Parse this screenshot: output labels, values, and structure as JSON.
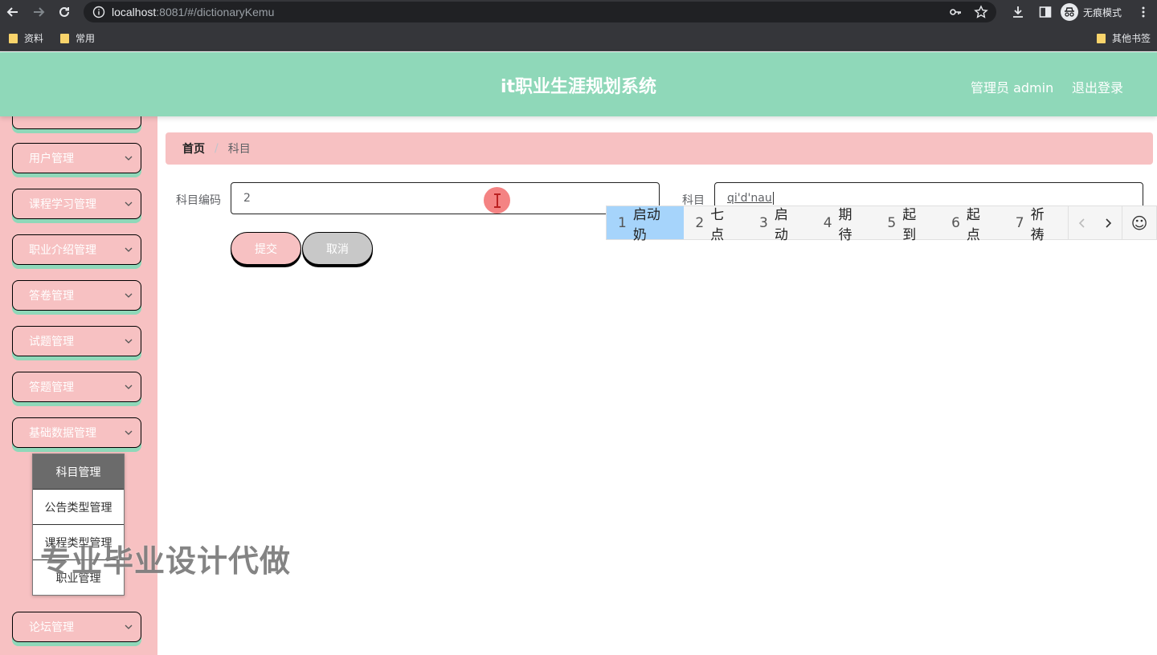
{
  "browser": {
    "url_host": "localhost",
    "url_rest": ":8081/#/dictionaryKemu",
    "incognito_label": "无痕模式",
    "bookmarks": [
      "资料",
      "常用"
    ],
    "other_bookmarks": "其他书签"
  },
  "header": {
    "title": "it职业生涯规划系统",
    "admin": "管理员 admin",
    "logout": "退出登录"
  },
  "sidebar": {
    "items": [
      {
        "label": "用户管理"
      },
      {
        "label": "课程学习管理"
      },
      {
        "label": "职业介绍管理"
      },
      {
        "label": "答卷管理"
      },
      {
        "label": "试题管理"
      },
      {
        "label": "答题管理"
      },
      {
        "label": "基础数据管理"
      },
      {
        "label": "论坛管理"
      }
    ],
    "submenu": [
      "科目管理",
      "公告类型管理",
      "课程类型管理",
      "职业管理"
    ]
  },
  "breadcrumb": {
    "home": "首页",
    "separator": "/",
    "current": "科目"
  },
  "form": {
    "code_label": "科目编码",
    "code_value": "2",
    "name_label": "科目",
    "name_value": "qi'd'nau",
    "submit": "提交",
    "cancel": "取消"
  },
  "ime": {
    "candidates": [
      {
        "n": "1",
        "text": "启动奶"
      },
      {
        "n": "2",
        "text": "七点"
      },
      {
        "n": "3",
        "text": "启动"
      },
      {
        "n": "4",
        "text": "期待"
      },
      {
        "n": "5",
        "text": "起到"
      },
      {
        "n": "6",
        "text": "起点"
      },
      {
        "n": "7",
        "text": "祈祷"
      }
    ],
    "emoji": "☺"
  },
  "watermark": "专业毕业设计代做",
  "colors": {
    "header": "#8fd8b9",
    "sidebar": "#f7c1c2",
    "ime_selected": "#a6d4fb"
  }
}
